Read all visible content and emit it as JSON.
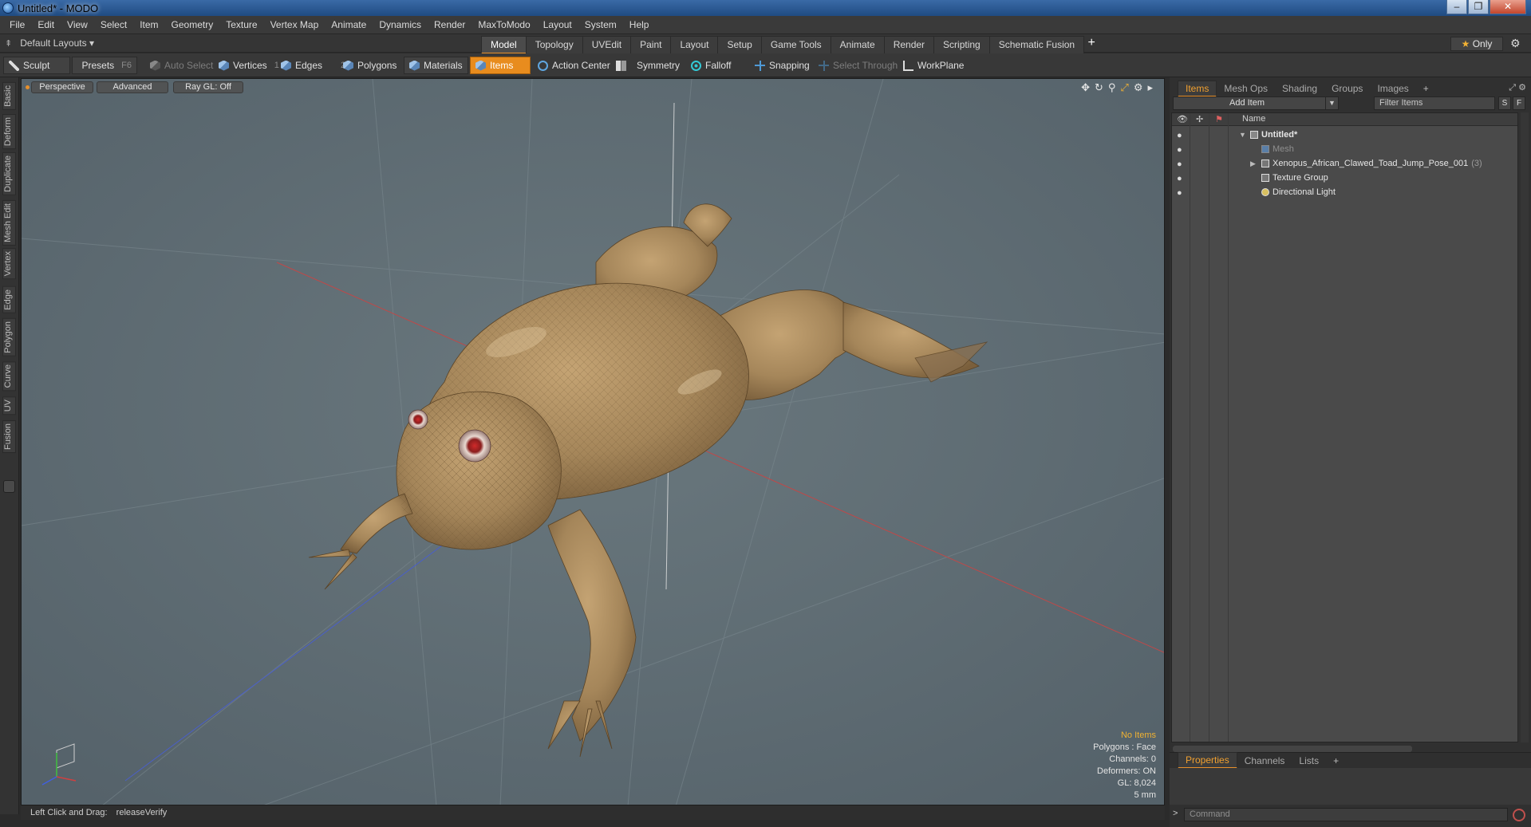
{
  "window": {
    "title": "Untitled* - MODO",
    "controls": [
      "–",
      "❐",
      "✕"
    ]
  },
  "menu": [
    "File",
    "Edit",
    "View",
    "Select",
    "Item",
    "Geometry",
    "Texture",
    "Vertex Map",
    "Animate",
    "Dynamics",
    "Render",
    "MaxToModo",
    "Layout",
    "System",
    "Help"
  ],
  "layout": {
    "selector": "Default Layouts ▾",
    "tabs": [
      "Model",
      "Topology",
      "UVEdit",
      "Paint",
      "Layout",
      "Setup",
      "Game Tools",
      "Animate",
      "Render",
      "Scripting",
      "Schematic Fusion"
    ],
    "active_tab": "Model",
    "add": "+",
    "only": "Only",
    "star": "★"
  },
  "toolbar": {
    "sculpt": "Sculpt",
    "presets": "Presets",
    "presets_key": "F6",
    "auto_select": "Auto Select",
    "vertices": "Vertices",
    "vertices_key": "1",
    "edges": "Edges",
    "edges_key": "2",
    "polygons": "Polygons",
    "materials": "Materials",
    "items": "Items",
    "action_center": "Action Center",
    "symmetry": "Symmetry",
    "falloff": "Falloff",
    "snapping": "Snapping",
    "select_through": "Select Through",
    "workplane": "WorkPlane"
  },
  "left_tabs": [
    "Basic",
    "Deform",
    "Duplicate",
    "Mesh Edit",
    "Vertex",
    "Edge",
    "Polygon",
    "Curve",
    "UV",
    "Fusion"
  ],
  "viewport": {
    "view": "Perspective",
    "shading": "Advanced",
    "raygl": "Ray GL: Off",
    "info": {
      "no_items": "No Items",
      "polygons": "Polygons : Face",
      "channels": "Channels: 0",
      "deformers": "Deformers: ON",
      "gl": "GL: 8,024",
      "scale": "5 mm"
    }
  },
  "status": {
    "hint": "Left Click and Drag:",
    "action": "releaseVerify"
  },
  "right_panel": {
    "tabs": [
      "Items",
      "Mesh Ops",
      "Shading",
      "Groups",
      "Images"
    ],
    "active_tab": "Items",
    "add_item": "Add Item",
    "filter": "Filter Items",
    "s_btn": "S",
    "f_btn": "F",
    "column_name": "Name",
    "items": [
      {
        "name": "Untitled*",
        "count": ""
      },
      {
        "name": "Mesh",
        "count": ""
      },
      {
        "name": "Xenopus_African_Clawed_Toad_Jump_Pose_001",
        "count": "(3)"
      },
      {
        "name": "Texture Group",
        "count": ""
      },
      {
        "name": "Directional Light",
        "count": ""
      }
    ],
    "props_tabs": [
      "Properties",
      "Channels",
      "Lists"
    ],
    "command_placeholder": "Command",
    "prompt": ">"
  },
  "colors": {
    "accent": "#e8902a",
    "viewport_bg": "#5f6d73",
    "frog_skin": "#a88a5e"
  }
}
